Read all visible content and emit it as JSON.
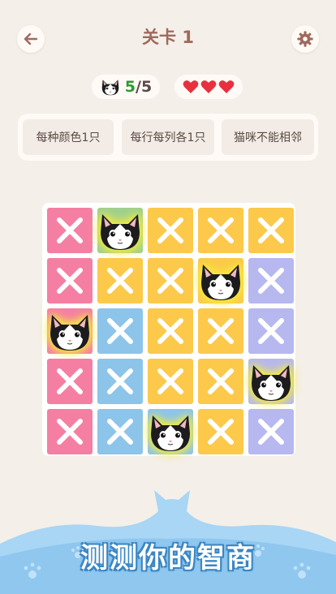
{
  "header": {
    "title": "关卡 1",
    "back_icon": "arrow-left-icon",
    "settings_icon": "gear-icon"
  },
  "status": {
    "cats_found": "5",
    "cats_total": "/5",
    "lives": 3,
    "heart_color": "#e8303f"
  },
  "rules": [
    "每种颜色1只",
    "每行每列各1只",
    "猫咪不能相邻"
  ],
  "colors": {
    "pink": "#f57fa3",
    "yellow": "#fcc94b",
    "purple": "#b6b8ef",
    "blue": "#8dc4ea",
    "green": "#9fd08e",
    "accent": "#a0695c"
  },
  "board": {
    "grid": [
      [
        "pink",
        "green",
        "yellow",
        "yellow",
        "yellow"
      ],
      [
        "pink",
        "yellow",
        "yellow",
        "yellow",
        "purple"
      ],
      [
        "pink",
        "blue",
        "yellow",
        "yellow",
        "purple"
      ],
      [
        "pink",
        "blue",
        "yellow",
        "yellow",
        "purple"
      ],
      [
        "pink",
        "blue",
        "blue",
        "yellow",
        "purple"
      ]
    ],
    "cats": [
      [
        0,
        1
      ],
      [
        1,
        3
      ],
      [
        2,
        0
      ],
      [
        3,
        4
      ],
      [
        4,
        2
      ]
    ]
  },
  "footer": {
    "slogan": "测测你的智商"
  }
}
